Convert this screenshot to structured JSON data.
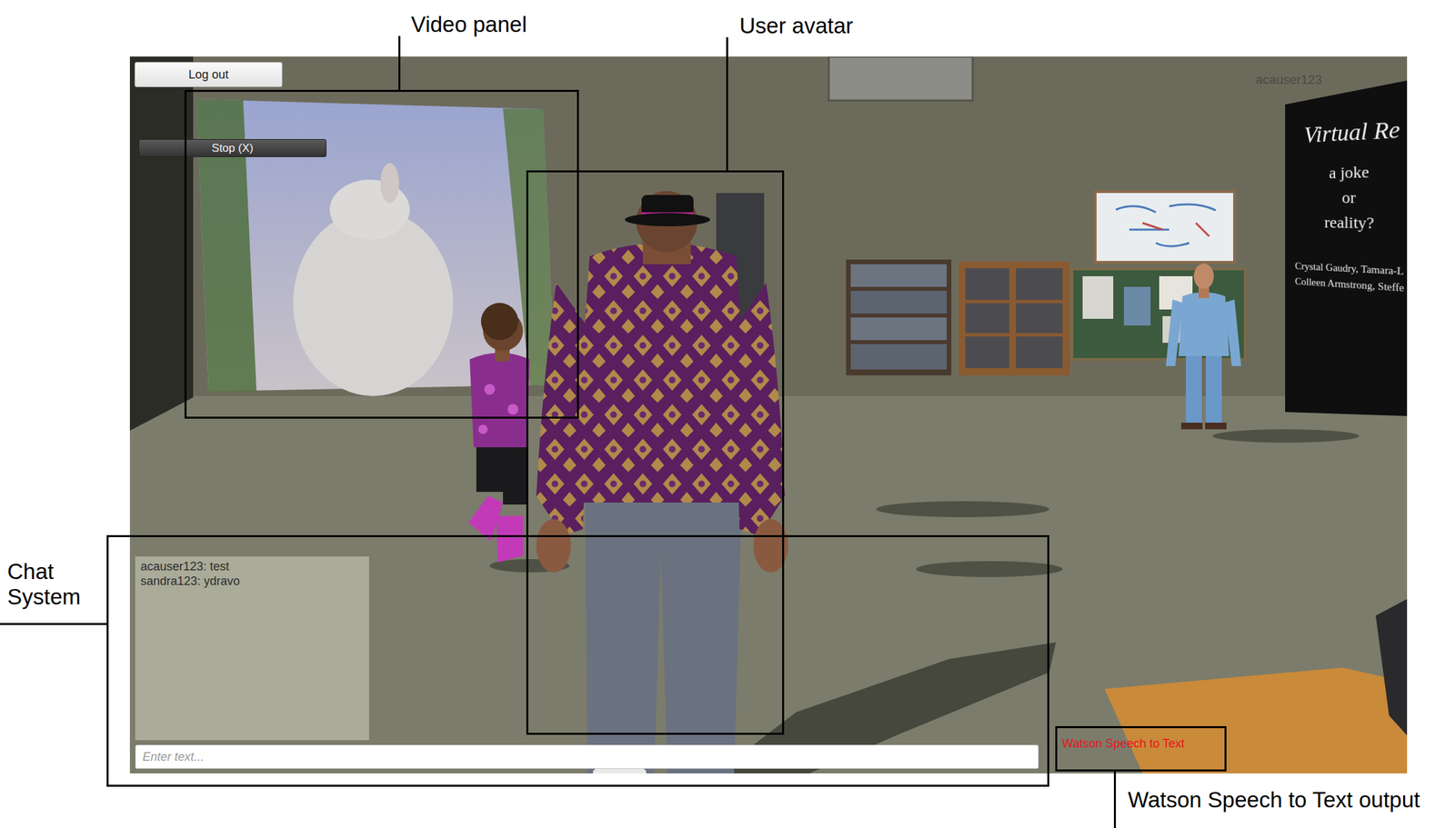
{
  "annotations": [
    {
      "label": "Video panel"
    },
    {
      "label": "User avatar"
    },
    {
      "label": "Chat System"
    },
    {
      "label": "Watson Speech to Text output"
    }
  ],
  "app": {
    "logout_button": "Log out",
    "stop_button": "Stop (X)",
    "username": "acauser123"
  },
  "chat": {
    "messages": [
      "acauser123: test",
      "sandra123: ydravo"
    ],
    "placeholder": "Enter text..."
  },
  "speech_to_text": {
    "output": "Watson Speech to Text"
  },
  "poster": {
    "lines": [
      "Virtual Re",
      "a joke",
      "or",
      "reality?"
    ],
    "authors": [
      "Crystal Gaudry, Tamara-L",
      "Colleen Armstrong, Steffe"
    ]
  }
}
